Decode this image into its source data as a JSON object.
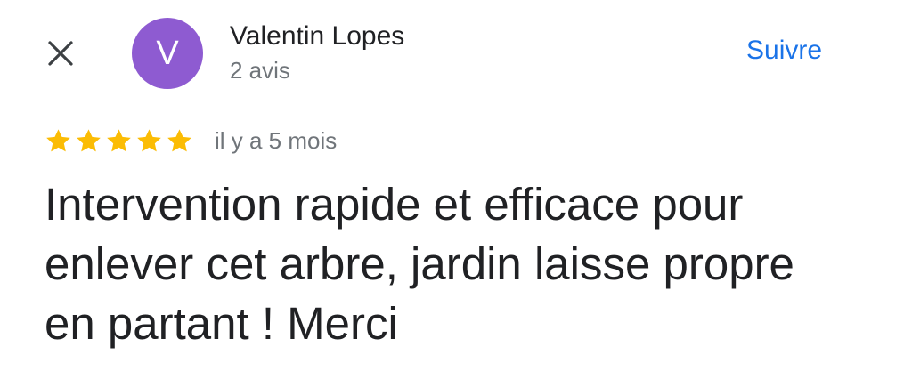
{
  "header": {
    "close_icon": "close-icon",
    "avatar_initial": "V",
    "avatar_color": "#8e5bd1",
    "reviewer_name": "Valentin Lopes",
    "review_count": "2 avis",
    "follow_label": "Suivre",
    "follow_color": "#1a73e8"
  },
  "review": {
    "rating": 5,
    "rating_max": 5,
    "star_color": "#fbbc04",
    "time_ago": "il y a 5 mois",
    "text": "Intervention rapide et efficace pour enlever cet arbre, jardin laisse propre en partant ! Merci"
  }
}
